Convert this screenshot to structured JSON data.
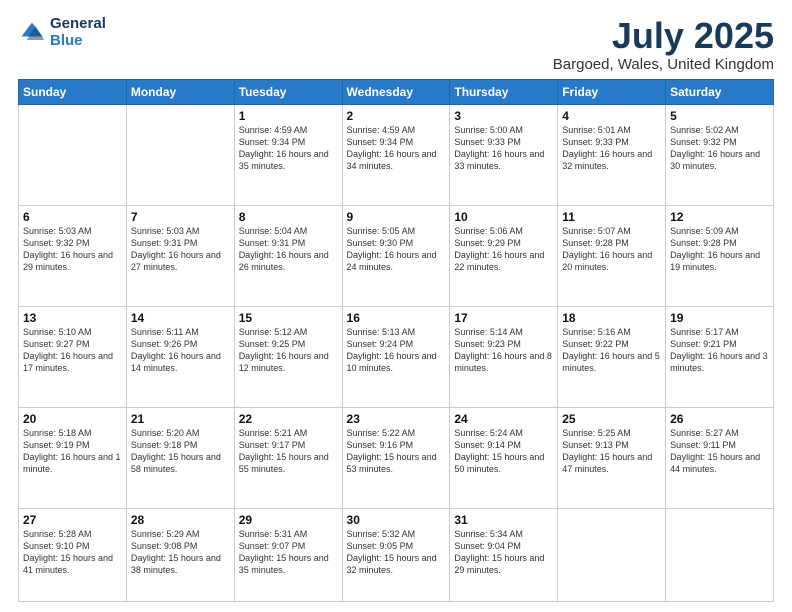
{
  "header": {
    "logo_line1": "General",
    "logo_line2": "Blue",
    "title": "July 2025",
    "subtitle": "Bargoed, Wales, United Kingdom"
  },
  "weekdays": [
    "Sunday",
    "Monday",
    "Tuesday",
    "Wednesday",
    "Thursday",
    "Friday",
    "Saturday"
  ],
  "weeks": [
    [
      {
        "day": "",
        "info": ""
      },
      {
        "day": "",
        "info": ""
      },
      {
        "day": "1",
        "info": "Sunrise: 4:59 AM\nSunset: 9:34 PM\nDaylight: 16 hours\nand 35 minutes."
      },
      {
        "day": "2",
        "info": "Sunrise: 4:59 AM\nSunset: 9:34 PM\nDaylight: 16 hours\nand 34 minutes."
      },
      {
        "day": "3",
        "info": "Sunrise: 5:00 AM\nSunset: 9:33 PM\nDaylight: 16 hours\nand 33 minutes."
      },
      {
        "day": "4",
        "info": "Sunrise: 5:01 AM\nSunset: 9:33 PM\nDaylight: 16 hours\nand 32 minutes."
      },
      {
        "day": "5",
        "info": "Sunrise: 5:02 AM\nSunset: 9:32 PM\nDaylight: 16 hours\nand 30 minutes."
      }
    ],
    [
      {
        "day": "6",
        "info": "Sunrise: 5:03 AM\nSunset: 9:32 PM\nDaylight: 16 hours\nand 29 minutes."
      },
      {
        "day": "7",
        "info": "Sunrise: 5:03 AM\nSunset: 9:31 PM\nDaylight: 16 hours\nand 27 minutes."
      },
      {
        "day": "8",
        "info": "Sunrise: 5:04 AM\nSunset: 9:31 PM\nDaylight: 16 hours\nand 26 minutes."
      },
      {
        "day": "9",
        "info": "Sunrise: 5:05 AM\nSunset: 9:30 PM\nDaylight: 16 hours\nand 24 minutes."
      },
      {
        "day": "10",
        "info": "Sunrise: 5:06 AM\nSunset: 9:29 PM\nDaylight: 16 hours\nand 22 minutes."
      },
      {
        "day": "11",
        "info": "Sunrise: 5:07 AM\nSunset: 9:28 PM\nDaylight: 16 hours\nand 20 minutes."
      },
      {
        "day": "12",
        "info": "Sunrise: 5:09 AM\nSunset: 9:28 PM\nDaylight: 16 hours\nand 19 minutes."
      }
    ],
    [
      {
        "day": "13",
        "info": "Sunrise: 5:10 AM\nSunset: 9:27 PM\nDaylight: 16 hours\nand 17 minutes."
      },
      {
        "day": "14",
        "info": "Sunrise: 5:11 AM\nSunset: 9:26 PM\nDaylight: 16 hours\nand 14 minutes."
      },
      {
        "day": "15",
        "info": "Sunrise: 5:12 AM\nSunset: 9:25 PM\nDaylight: 16 hours\nand 12 minutes."
      },
      {
        "day": "16",
        "info": "Sunrise: 5:13 AM\nSunset: 9:24 PM\nDaylight: 16 hours\nand 10 minutes."
      },
      {
        "day": "17",
        "info": "Sunrise: 5:14 AM\nSunset: 9:23 PM\nDaylight: 16 hours\nand 8 minutes."
      },
      {
        "day": "18",
        "info": "Sunrise: 5:16 AM\nSunset: 9:22 PM\nDaylight: 16 hours\nand 5 minutes."
      },
      {
        "day": "19",
        "info": "Sunrise: 5:17 AM\nSunset: 9:21 PM\nDaylight: 16 hours\nand 3 minutes."
      }
    ],
    [
      {
        "day": "20",
        "info": "Sunrise: 5:18 AM\nSunset: 9:19 PM\nDaylight: 16 hours\nand 1 minute."
      },
      {
        "day": "21",
        "info": "Sunrise: 5:20 AM\nSunset: 9:18 PM\nDaylight: 15 hours\nand 58 minutes."
      },
      {
        "day": "22",
        "info": "Sunrise: 5:21 AM\nSunset: 9:17 PM\nDaylight: 15 hours\nand 55 minutes."
      },
      {
        "day": "23",
        "info": "Sunrise: 5:22 AM\nSunset: 9:16 PM\nDaylight: 15 hours\nand 53 minutes."
      },
      {
        "day": "24",
        "info": "Sunrise: 5:24 AM\nSunset: 9:14 PM\nDaylight: 15 hours\nand 50 minutes."
      },
      {
        "day": "25",
        "info": "Sunrise: 5:25 AM\nSunset: 9:13 PM\nDaylight: 15 hours\nand 47 minutes."
      },
      {
        "day": "26",
        "info": "Sunrise: 5:27 AM\nSunset: 9:11 PM\nDaylight: 15 hours\nand 44 minutes."
      }
    ],
    [
      {
        "day": "27",
        "info": "Sunrise: 5:28 AM\nSunset: 9:10 PM\nDaylight: 15 hours\nand 41 minutes."
      },
      {
        "day": "28",
        "info": "Sunrise: 5:29 AM\nSunset: 9:08 PM\nDaylight: 15 hours\nand 38 minutes."
      },
      {
        "day": "29",
        "info": "Sunrise: 5:31 AM\nSunset: 9:07 PM\nDaylight: 15 hours\nand 35 minutes."
      },
      {
        "day": "30",
        "info": "Sunrise: 5:32 AM\nSunset: 9:05 PM\nDaylight: 15 hours\nand 32 minutes."
      },
      {
        "day": "31",
        "info": "Sunrise: 5:34 AM\nSunset: 9:04 PM\nDaylight: 15 hours\nand 29 minutes."
      },
      {
        "day": "",
        "info": ""
      },
      {
        "day": "",
        "info": ""
      }
    ]
  ]
}
